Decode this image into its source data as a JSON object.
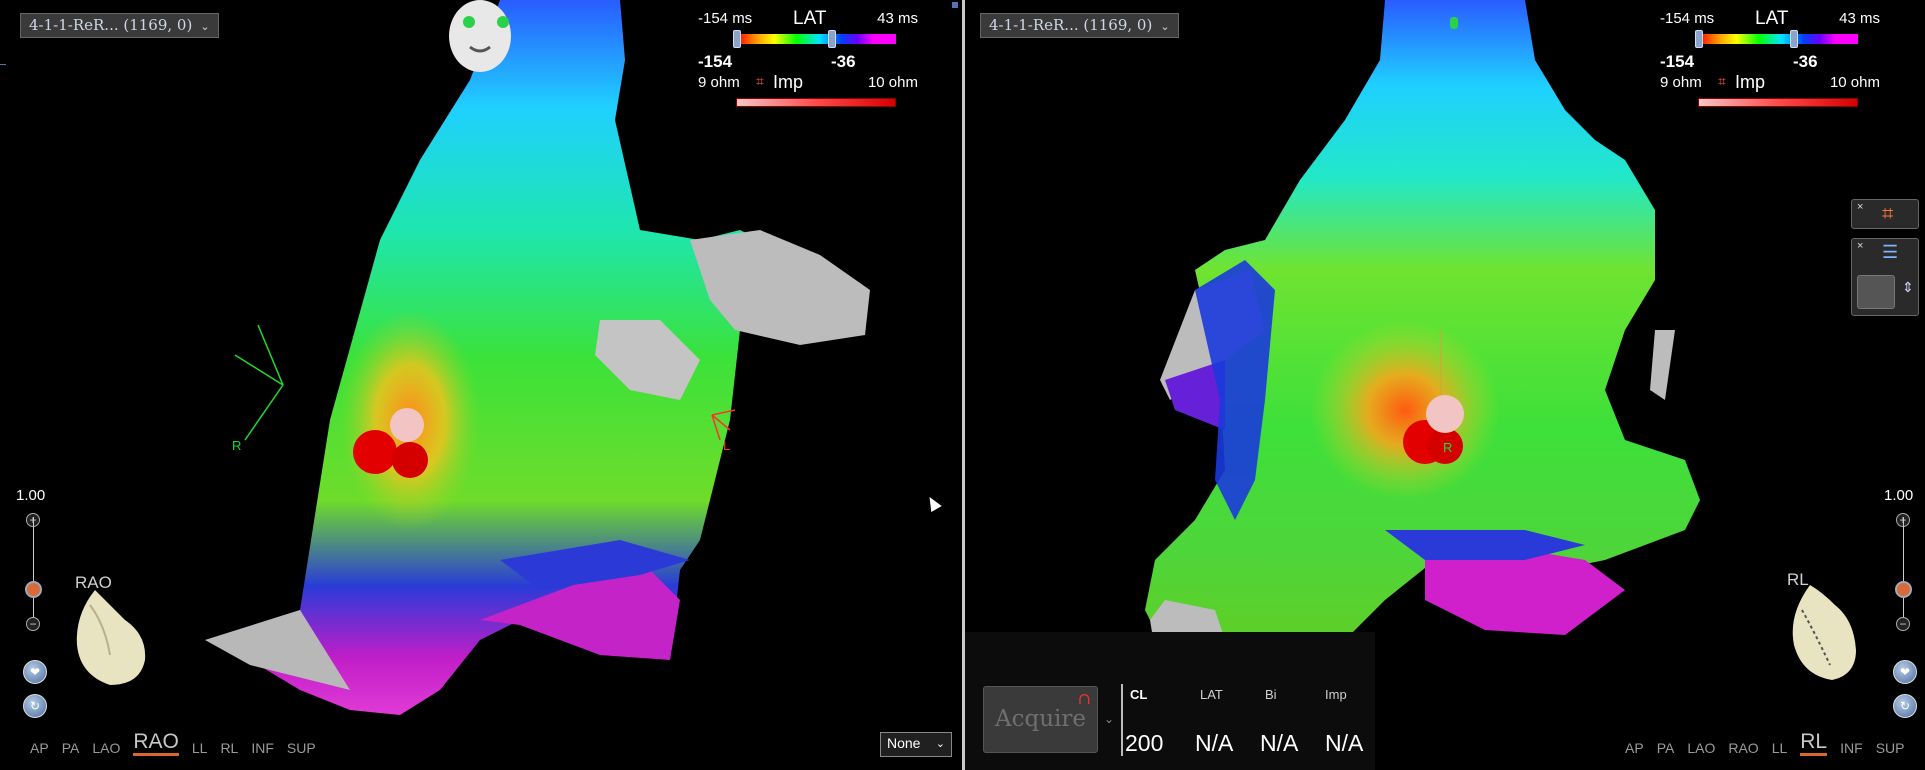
{
  "left_pane": {
    "map_select": "4-1-1-ReR... (1169, 0)",
    "legend": {
      "lat_min": "-154 ms",
      "lat_title": "LAT",
      "lat_max": "43 ms",
      "lat_low": "-154",
      "lat_high": "-36",
      "imp_min": "9 ohm",
      "imp_title": "Imp",
      "imp_max": "10 ohm"
    },
    "axis_labels": {
      "r": "R",
      "l": "L"
    },
    "zoom_value": "1.00",
    "orientation_label": "RAO",
    "views": [
      "AP",
      "PA",
      "LAO",
      "RAO",
      "LL",
      "RL",
      "INF",
      "SUP"
    ],
    "active_view": "RAO",
    "projection_select": "None"
  },
  "right_pane": {
    "map_select": "4-1-1-ReR... (1169, 0)",
    "legend": {
      "lat_min": "-154 ms",
      "lat_title": "LAT",
      "lat_max": "43 ms",
      "lat_low": "-154",
      "lat_high": "-36",
      "imp_min": "9 ohm",
      "imp_title": "Imp",
      "imp_max": "10 ohm"
    },
    "catheter_label": "R",
    "zoom_value": "1.00",
    "orientation_label": "RL",
    "views": [
      "AP",
      "PA",
      "LAO",
      "RAO",
      "LL",
      "RL",
      "INF",
      "SUP"
    ],
    "active_view": "RL",
    "acquire": {
      "button": "Acquire",
      "headers": [
        "CL",
        "LAT",
        "Bi",
        "Imp"
      ],
      "values": [
        "200",
        "N/A",
        "N/A",
        "N/A"
      ]
    }
  },
  "colors": {
    "accent": "#d8682d",
    "lat_handle": "#8aa3c8",
    "background": "#000000"
  }
}
